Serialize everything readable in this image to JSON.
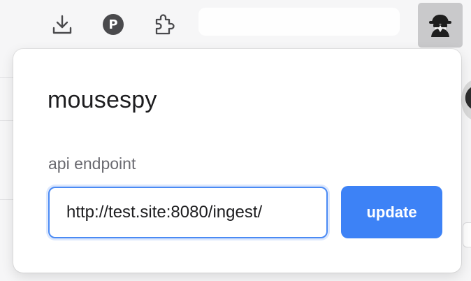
{
  "toolbar": {
    "icons": {
      "download": "download-icon",
      "profile": "profile-avatar-icon",
      "extensions": "puzzle-piece-icon",
      "active_extension": "spy-detective-icon"
    },
    "profile_initial": "P"
  },
  "popup": {
    "title": "mousespy",
    "endpoint_label": "api endpoint",
    "endpoint_value": "http://test.site:8080/ingest/",
    "update_label": "update"
  },
  "colors": {
    "accent": "#3d82f6",
    "input_border": "#4a8af4",
    "title_text": "#1d1d1f",
    "label_text": "#6a6a70",
    "toolbar_bg": "#f6f6f7",
    "extension_button_bg": "#c9c9cb"
  }
}
